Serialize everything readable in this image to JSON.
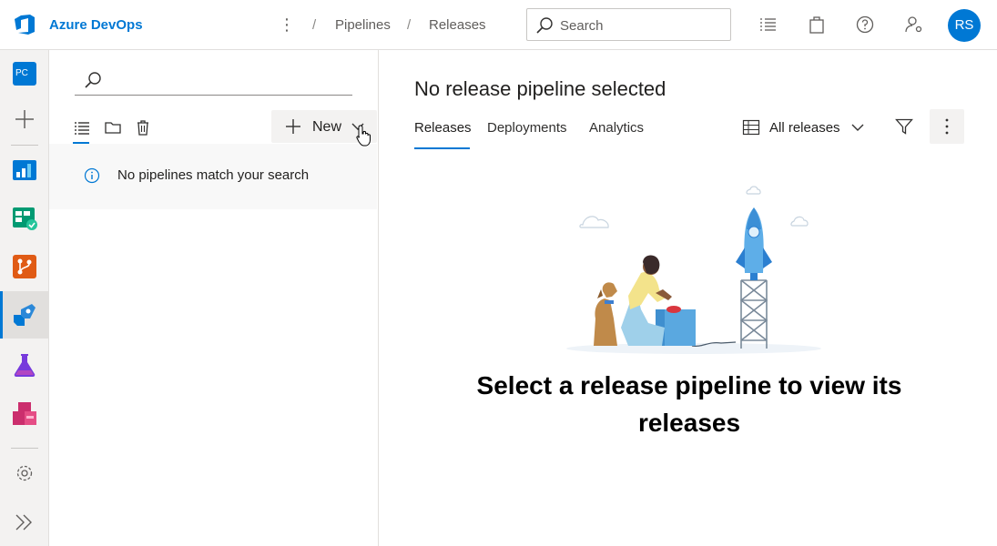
{
  "header": {
    "brand": "Azure DevOps",
    "breadcrumbs": [
      "Pipelines",
      "Releases"
    ],
    "search_placeholder": "Search",
    "avatar_initials": "RS"
  },
  "leftnav": {
    "project_initials": "PC",
    "items": [
      "new",
      "overview",
      "boards",
      "repos",
      "pipelines",
      "test-plans",
      "artifacts",
      "settings",
      "expand"
    ]
  },
  "leftpanel": {
    "new_label": "New",
    "empty_message": "No pipelines match your search"
  },
  "main": {
    "title": "No release pipeline selected",
    "tabs": [
      "Releases",
      "Deployments",
      "Analytics"
    ],
    "active_tab": "Releases",
    "view_filter": "All releases",
    "headline": "Select a release pipeline to view its releases"
  },
  "colors": {
    "accent": "#0078d4",
    "nav_bg": "#f3f2f1"
  }
}
